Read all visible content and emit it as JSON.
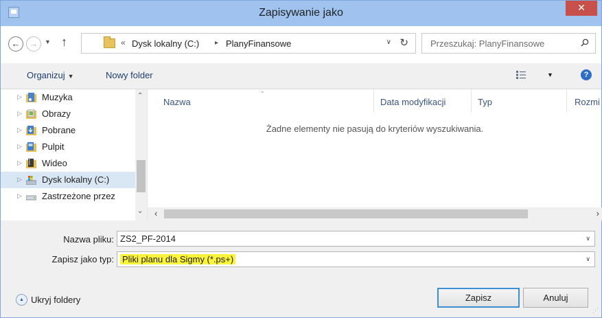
{
  "window": {
    "title": "Zapisywanie jako",
    "close_glyph": "✕"
  },
  "nav": {
    "back_glyph": "←",
    "forward_glyph": "→",
    "recent_glyph": "▼",
    "up_glyph": "↑"
  },
  "address": {
    "prefix": "«",
    "crumbs": [
      "Dysk lokalny (C:)",
      "PlanyFinansowe"
    ],
    "sep": "▸",
    "dropdown_glyph": "∨",
    "refresh_glyph": "↻"
  },
  "search": {
    "placeholder": "Przeszukaj: PlanyFinansowe"
  },
  "toolbar": {
    "organize": "Organizuj",
    "organize_dd": "▼",
    "new_folder": "Nowy folder",
    "view_dd": "▼",
    "help": "?"
  },
  "navpane": {
    "items": [
      {
        "label": "Muzyka",
        "icon": "music-folder-icon"
      },
      {
        "label": "Obrazy",
        "icon": "pictures-folder-icon"
      },
      {
        "label": "Pobrane",
        "icon": "downloads-folder-icon"
      },
      {
        "label": "Pulpit",
        "icon": "desktop-folder-icon"
      },
      {
        "label": "Wideo",
        "icon": "video-folder-icon"
      },
      {
        "label": "Dysk lokalny (C:)",
        "icon": "local-disk-icon"
      },
      {
        "label": "Zastrzeżone przez",
        "icon": "drive-icon"
      }
    ],
    "expand_glyph": "▷",
    "scroll_up": "⌃",
    "scroll_down": "⌄"
  },
  "filelist": {
    "columns": [
      "Nazwa",
      "Data modyfikacji",
      "Typ",
      "Rozmi"
    ],
    "sort_glyph": "⌃",
    "empty_message": "Żadne elementy nie pasują do kryteriów wyszukiwania.",
    "scroll_left": "‹",
    "scroll_right": "›"
  },
  "form": {
    "filename_label": "Nazwa pliku:",
    "filename_value": "ZS2_PF-2014",
    "filetype_label": "Zapisz jako typ:",
    "filetype_value": "Pliki planu dla Sigmy (*.ps+)",
    "dropdown_glyph": "∨"
  },
  "footer": {
    "hide_folders": "Ukryj foldery",
    "hide_glyph": "▲",
    "save": "Zapisz",
    "cancel": "Anuluj",
    "grip": "⋰"
  },
  "colors": {
    "accent": "#3b8fd6",
    "titlebar": "#9fc3ee",
    "close": "#c7504a",
    "highlight": "#fbf43a"
  }
}
